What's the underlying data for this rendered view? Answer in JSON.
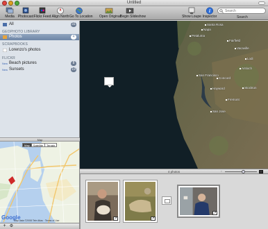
{
  "window": {
    "title": "Untitled"
  },
  "toolbar": {
    "items": [
      {
        "label": "Media",
        "icon": "media-icon"
      },
      {
        "label": "Photocast",
        "icon": "photocast-icon"
      },
      {
        "label": "Flickr Feed",
        "icon": "flickr-feed-icon"
      },
      {
        "label": "Align North",
        "icon": "compass-icon"
      },
      {
        "label": "Go To Location",
        "icon": "globe-icon"
      },
      {
        "label": "Open Original",
        "icon": "open-original-icon"
      },
      {
        "label": "Begin Slideshow",
        "icon": "slideshow-icon"
      },
      {
        "label": "Show Loupe",
        "icon": "loupe-icon"
      },
      {
        "label": "Inspector",
        "icon": "info-icon"
      }
    ],
    "search": {
      "placeholder": "Search",
      "label": "Search"
    }
  },
  "sidebar": {
    "all": {
      "label": "All",
      "count": "31"
    },
    "sections": {
      "library": "GEOPHOTO LIBRARY",
      "scrapbooks": "SCRAPBOOKS",
      "flickr": "FLICKR"
    },
    "photos": {
      "label": "Photos",
      "count": "4"
    },
    "scrapbook_item": {
      "label": "Lorenzo's photos"
    },
    "flickr_items": [
      {
        "badge": "New",
        "label": "Beach pictures",
        "count": "8"
      },
      {
        "badge": "New",
        "label": "Sunsets",
        "count": "19"
      }
    ]
  },
  "map_pane": {
    "label": "Map",
    "tabs": [
      "Map",
      "Satellite",
      "Terrain"
    ],
    "active_tab": "Map",
    "logo": "Google",
    "copyright": "Map data ©2008 Tele Atlas · Terms of Use"
  },
  "main_map": {
    "places": [
      {
        "name": "Petaluma"
      },
      {
        "name": "Napa"
      },
      {
        "name": "Fairfield"
      },
      {
        "name": "Vacaville"
      },
      {
        "name": "Santa Rosa"
      },
      {
        "name": "Antioch"
      },
      {
        "name": "Concord"
      },
      {
        "name": "San Francisco"
      },
      {
        "name": "Hayward"
      },
      {
        "name": "Fremont"
      },
      {
        "name": "San Jose"
      },
      {
        "name": "Stockton"
      },
      {
        "name": "Lodi"
      }
    ]
  },
  "status": {
    "photo_count": "4 photos"
  },
  "colors": {
    "selection": "#6e86a6",
    "satellite_dark": "#111f26",
    "land": "#6b6a4e"
  }
}
